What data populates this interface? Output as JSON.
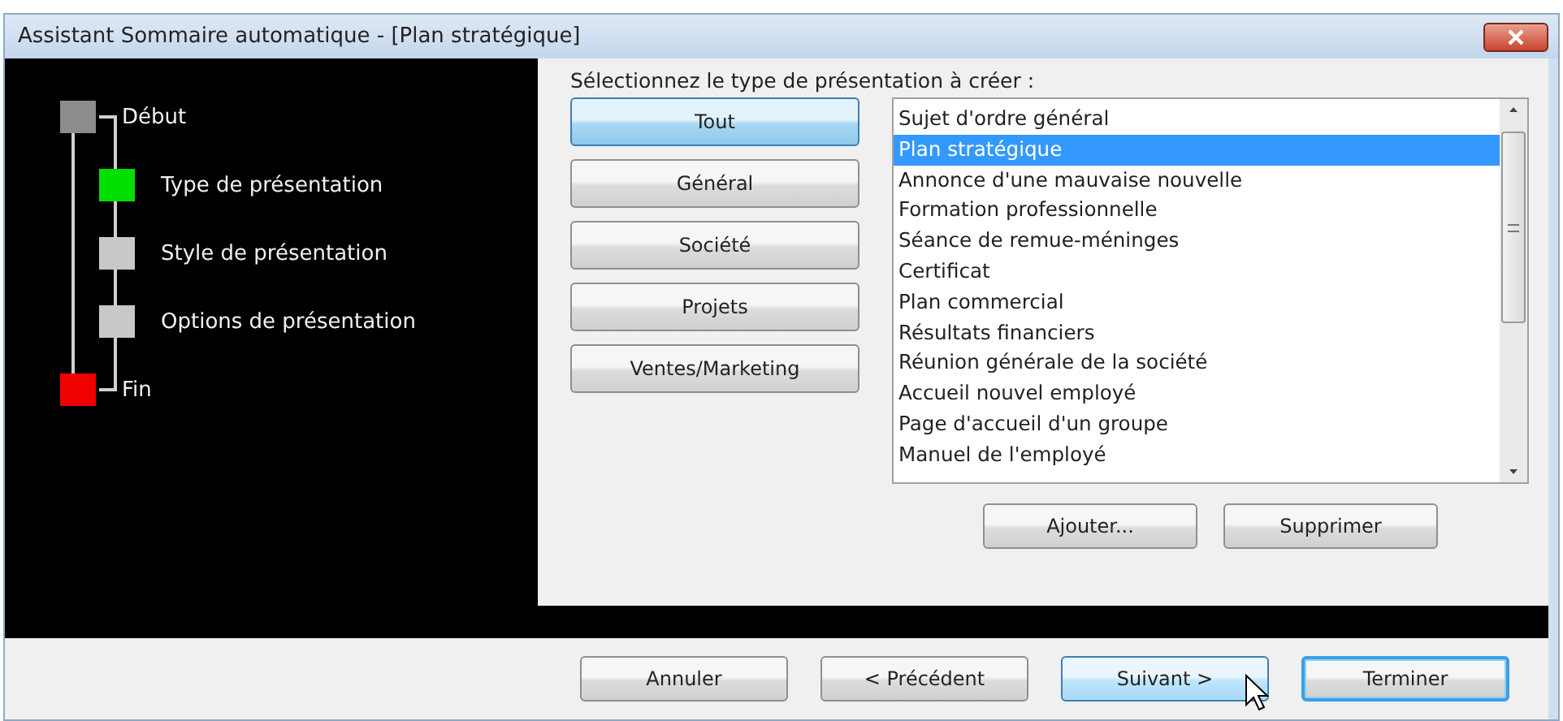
{
  "window": {
    "title": "Assistant Sommaire automatique - [Plan stratégique]"
  },
  "steps": [
    {
      "label": "Début",
      "color": "#8c8c8c",
      "kind": "outer"
    },
    {
      "label": "Type de présentation",
      "color": "#00e000",
      "kind": "inner"
    },
    {
      "label": "Style de présentation",
      "color": "#c8c8c8",
      "kind": "inner"
    },
    {
      "label": "Options de présentation",
      "color": "#c8c8c8",
      "kind": "inner"
    },
    {
      "label": "Fin",
      "color": "#f00000",
      "kind": "outer"
    }
  ],
  "prompt": "Sélectionnez le type de présentation à créer :",
  "categories": [
    {
      "label": "Tout",
      "selected": true
    },
    {
      "label": "Général",
      "selected": false
    },
    {
      "label": "Société",
      "selected": false
    },
    {
      "label": "Projets",
      "selected": false
    },
    {
      "label": "Ventes/Marketing",
      "selected": false
    }
  ],
  "types": [
    {
      "label": "Sujet d'ordre général",
      "selected": false
    },
    {
      "label": "Plan stratégique",
      "selected": true
    },
    {
      "label": "Annonce d'une mauvaise nouvelle",
      "selected": false
    },
    {
      "label": "Formation professionnelle",
      "selected": false
    },
    {
      "label": "Séance de remue-méninges",
      "selected": false
    },
    {
      "label": "Certificat",
      "selected": false
    },
    {
      "label": "Plan commercial",
      "selected": false
    },
    {
      "label": "Résultats financiers",
      "selected": false
    },
    {
      "label": "Réunion générale de la société",
      "selected": false
    },
    {
      "label": "Accueil nouvel employé",
      "selected": false
    },
    {
      "label": "Page d'accueil d'un groupe",
      "selected": false
    },
    {
      "label": "Manuel de l'employé",
      "selected": false
    }
  ],
  "list_buttons": [
    {
      "label": "Ajouter..."
    },
    {
      "label": "Supprimer"
    }
  ],
  "footer_buttons": [
    {
      "label": "Annuler",
      "hovered": false,
      "default": false
    },
    {
      "label": "< Précédent",
      "hovered": false,
      "default": false
    },
    {
      "label": "Suivant >",
      "hovered": true,
      "default": false
    },
    {
      "label": "Terminer",
      "hovered": false,
      "default": true
    }
  ]
}
